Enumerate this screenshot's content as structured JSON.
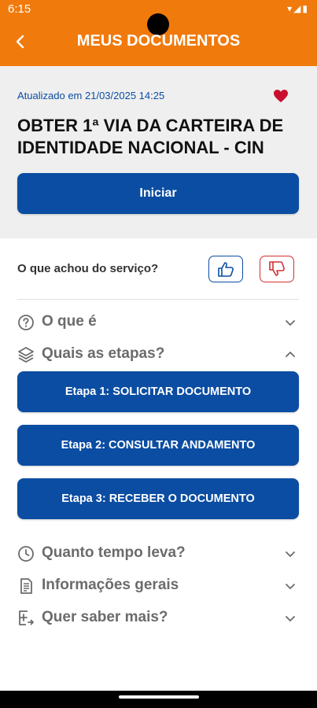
{
  "status": {
    "time": "6:15"
  },
  "header": {
    "title": "MEUS DOCUMENTOS"
  },
  "card": {
    "updated": "Atualizado em 21/03/2025 14:25",
    "title": "OBTER 1ª VIA DA CARTEIRA DE IDENTIDADE NACIONAL - CIN",
    "start_label": "Iniciar"
  },
  "feedback": {
    "question": "O que achou do serviço?"
  },
  "sections": {
    "what": "O que é",
    "steps": "Quais as etapas?",
    "time": "Quanto tempo leva?",
    "info": "Informações gerais",
    "more": "Quer saber mais?"
  },
  "steps": [
    "Etapa 1: SOLICITAR DOCUMENTO",
    "Etapa 2: CONSULTAR ANDAMENTO",
    "Etapa 3: RECEBER O DOCUMENTO"
  ],
  "colors": {
    "header": "#F07A0C",
    "primary": "#0B4DA2",
    "favorite": "#C8102E",
    "dislike": "#D32F2F"
  }
}
